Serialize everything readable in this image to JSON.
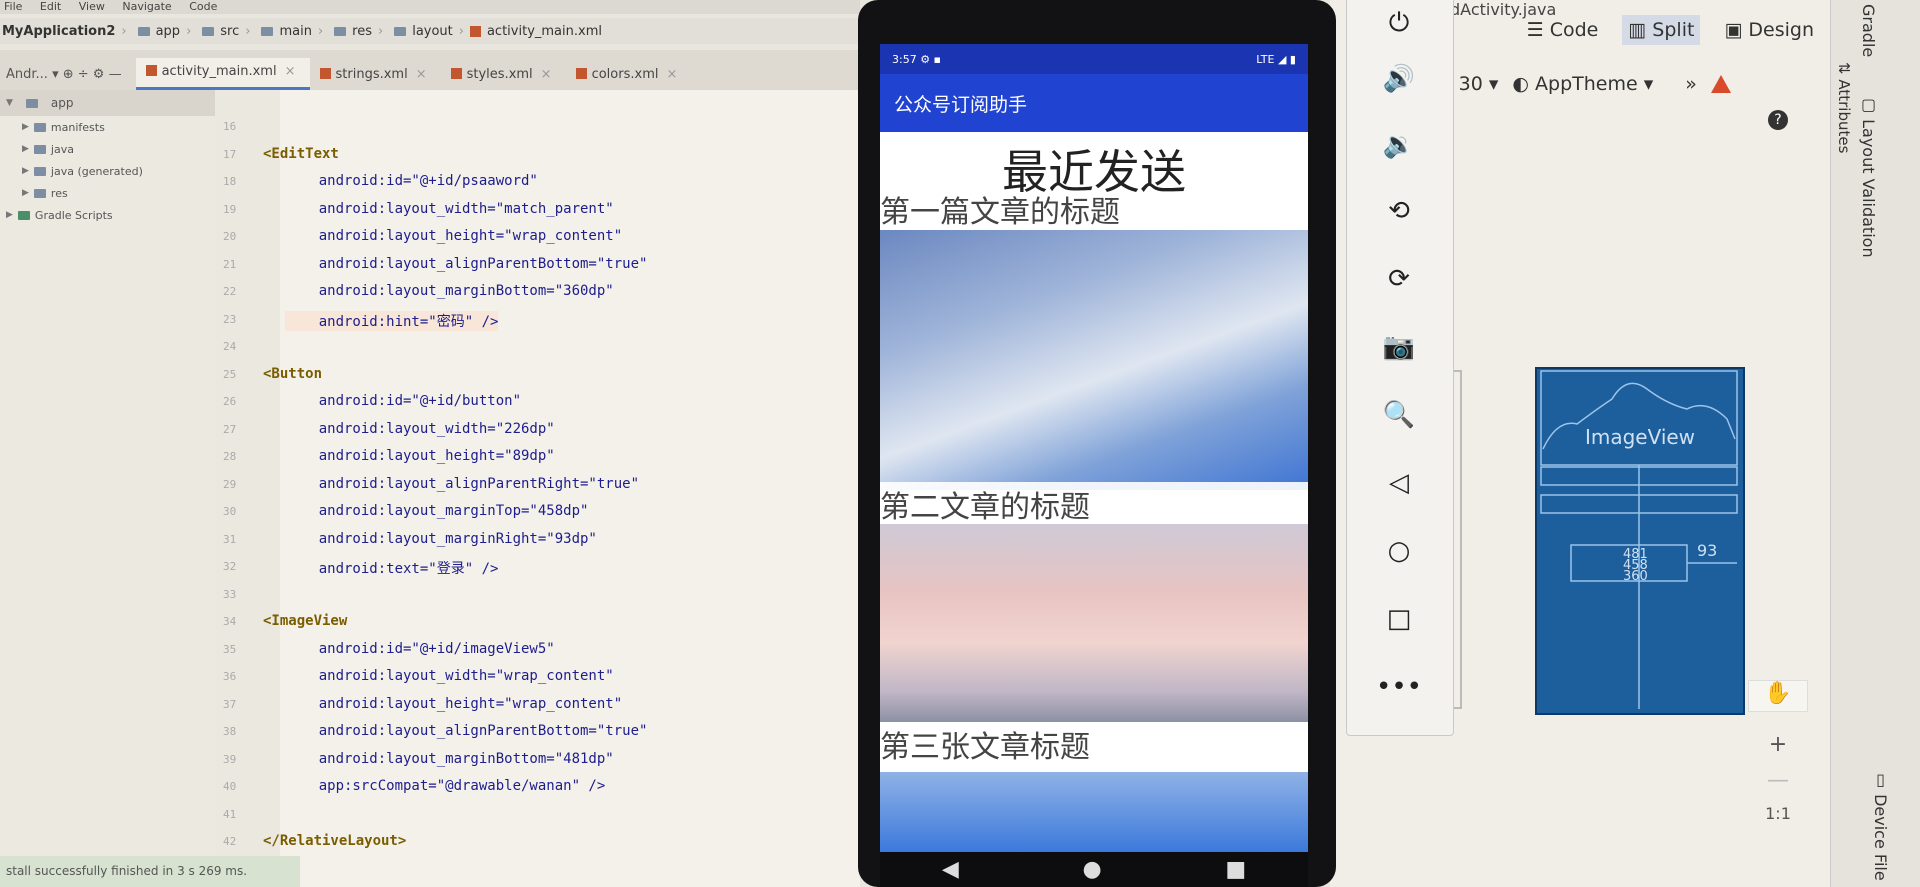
{
  "menubar": {
    "items": [
      "File",
      "Edit",
      "View",
      "Navigate",
      "Code"
    ]
  },
  "breadcrumb": [
    "MyApplication2",
    "app",
    "src",
    "main",
    "res",
    "layout",
    "activity_main.xml"
  ],
  "file_tabs": [
    {
      "label": "activity_main.xml",
      "active": true
    },
    {
      "label": "strings.xml",
      "active": false
    },
    {
      "label": "styles.xml",
      "active": false
    },
    {
      "label": "colors.xml",
      "active": false
    }
  ],
  "project_panel": {
    "header": "Andr...",
    "root": "app",
    "nodes": [
      "manifests",
      "java",
      "java (generated)",
      "res",
      "Gradle Scripts"
    ]
  },
  "code_lines": [
    {
      "n": "16",
      "text": ""
    },
    {
      "n": "17",
      "text": "<EditText",
      "kind": "tag"
    },
    {
      "n": "18",
      "text": "    android:id=\"@+id/psaaword\""
    },
    {
      "n": "19",
      "text": "    android:layout_width=\"match_parent\""
    },
    {
      "n": "20",
      "text": "    android:layout_height=\"wrap_content\""
    },
    {
      "n": "21",
      "text": "    android:layout_alignParentBottom=\"true\""
    },
    {
      "n": "22",
      "text": "    android:layout_marginBottom=\"360dp\""
    },
    {
      "n": "23",
      "text": "    android:hint=\"密码\" />",
      "highlight": true
    },
    {
      "n": "24",
      "text": ""
    },
    {
      "n": "25",
      "text": "<Button",
      "kind": "tag"
    },
    {
      "n": "26",
      "text": "    android:id=\"@+id/button\""
    },
    {
      "n": "27",
      "text": "    android:layout_width=\"226dp\""
    },
    {
      "n": "28",
      "text": "    android:layout_height=\"89dp\""
    },
    {
      "n": "29",
      "text": "    android:layout_alignParentRight=\"true\""
    },
    {
      "n": "30",
      "text": "    android:layout_marginTop=\"458dp\""
    },
    {
      "n": "31",
      "text": "    android:layout_marginRight=\"93dp\""
    },
    {
      "n": "32",
      "text": "    android:text=\"登录\" />"
    },
    {
      "n": "33",
      "text": ""
    },
    {
      "n": "34",
      "text": "<ImageView",
      "kind": "tag"
    },
    {
      "n": "35",
      "text": "    android:id=\"@+id/imageView5\""
    },
    {
      "n": "36",
      "text": "    android:layout_width=\"wrap_content\""
    },
    {
      "n": "37",
      "text": "    android:layout_height=\"wrap_content\""
    },
    {
      "n": "38",
      "text": "    android:layout_alignParentBottom=\"true\""
    },
    {
      "n": "39",
      "text": "    android:layout_marginBottom=\"481dp\""
    },
    {
      "n": "40",
      "text": "    app:srcCompat=\"@drawable/wanan\" />"
    },
    {
      "n": "41",
      "text": ""
    },
    {
      "n": "42",
      "text": "</RelativeLayout>",
      "kind": "tag"
    }
  ],
  "status_text": "stall successfully finished in 3 s 269 ms.",
  "editor_tabs_top_right": "dActivity.java",
  "view_modes": {
    "code": "Code",
    "split": "Split",
    "design": "Design"
  },
  "design_toolbar": {
    "api": "30",
    "theme": "AppTheme"
  },
  "right_strip": {
    "gradle": "Gradle",
    "attributes": "Attributes",
    "layout_validation": "Layout Validation",
    "device_file": "Device File"
  },
  "blueprint": {
    "image_label": "ImageView",
    "margin_right": "93",
    "values": [
      "481",
      "458",
      "360"
    ]
  },
  "zoom": {
    "plus": "+",
    "minus": "—",
    "ratio": "1:1"
  },
  "phone": {
    "time": "3:57",
    "status_right": "LTE",
    "app_title": "公众号订阅助手",
    "heading": "最近发送",
    "articles": [
      "第一篇文章的标题",
      "第二文章的标题",
      "第三张文章标题"
    ]
  },
  "emulator_controls": [
    "power-icon",
    "volume-up-icon",
    "volume-down-icon",
    "rotate-left-icon",
    "rotate-right-icon",
    "camera-icon",
    "zoom-icon",
    "back-icon",
    "home-icon",
    "overview-icon",
    "more-icon"
  ]
}
